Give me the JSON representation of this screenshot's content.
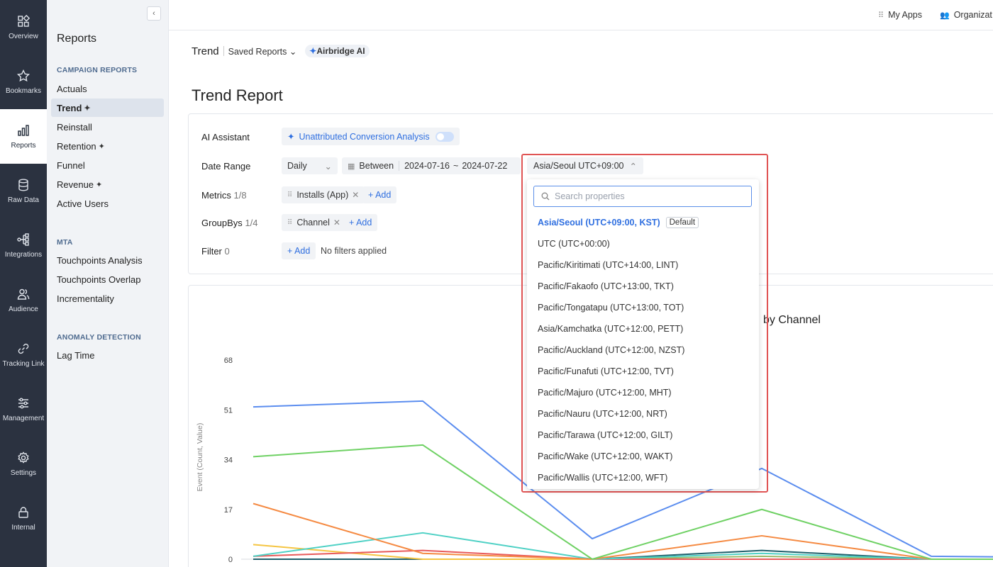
{
  "rail": {
    "items": [
      {
        "label": "Overview",
        "icon": "grid-icon"
      },
      {
        "label": "Bookmarks",
        "icon": "star-icon"
      },
      {
        "label": "Reports",
        "icon": "bar-chart-icon"
      },
      {
        "label": "Raw Data",
        "icon": "database-icon"
      },
      {
        "label": "Integrations",
        "icon": "integrations-icon"
      },
      {
        "label": "Audience",
        "icon": "users-icon"
      },
      {
        "label": "Tracking Link",
        "icon": "link-icon"
      },
      {
        "label": "Management",
        "icon": "sliders-icon"
      },
      {
        "label": "Settings",
        "icon": "gear-icon"
      },
      {
        "label": "Internal",
        "icon": "lock-icon"
      }
    ]
  },
  "sidebar": {
    "title": "Reports",
    "collapse": "‹",
    "sections": [
      {
        "label": "CAMPAIGN REPORTS",
        "items": [
          "Actuals",
          "Trend",
          "Reinstall",
          "Retention",
          "Funnel",
          "Revenue",
          "Active Users"
        ]
      },
      {
        "label": "MTA",
        "items": [
          "Touchpoints Analysis",
          "Touchpoints Overlap",
          "Incrementality"
        ]
      },
      {
        "label": "ANOMALY DETECTION",
        "items": [
          "Lag Time"
        ]
      }
    ]
  },
  "topbar": {
    "my_apps": "My Apps",
    "organization": "Organizat"
  },
  "breadcrumb": {
    "trend": "Trend",
    "saved_reports": "Saved Reports",
    "airbridge_ai": "Airbridge AI"
  },
  "page_title": "Trend Report",
  "settings": {
    "ai_assistant_label": "AI Assistant",
    "ai_assistant_chip": "Unattributed Conversion Analysis",
    "date_range_label": "Date Range",
    "granularity": "Daily",
    "between": "Between",
    "date_start": "2024-07-16",
    "date_sep": "~",
    "date_end": "2024-07-22",
    "metrics_label": "Metrics",
    "metrics_count": "1/8",
    "metric_chip": "Installs (App)",
    "add": "+ Add",
    "groupbys_label": "GroupBys",
    "groupbys_count": "1/4",
    "groupby_chip": "Channel",
    "filter_label": "Filter",
    "filter_count": "0",
    "no_filters": "No filters applied"
  },
  "timezone": {
    "selected": "Asia/Seoul UTC+09:00",
    "search_placeholder": "Search properties",
    "default_tag": "Default",
    "options": [
      "Asia/Seoul (UTC+09:00, KST)",
      "UTC (UTC+00:00)",
      "Pacific/Kiritimati (UTC+14:00, LINT)",
      "Pacific/Fakaofo (UTC+13:00, TKT)",
      "Pacific/Tongatapu (UTC+13:00, TOT)",
      "Asia/Kamchatka (UTC+12:00, PETT)",
      "Pacific/Auckland (UTC+12:00, NZST)",
      "Pacific/Funafuti (UTC+12:00, TVT)",
      "Pacific/Majuro (UTC+12:00, MHT)",
      "Pacific/Nauru (UTC+12:00, NRT)",
      "Pacific/Tarawa (UTC+12:00, GILT)",
      "Pacific/Wake (UTC+12:00, WAKT)",
      "Pacific/Wallis (UTC+12:00, WFT)"
    ]
  },
  "chart_data": {
    "type": "line",
    "title": "by Channel",
    "ylabel": "Event (Count, Value)",
    "ylim": [
      0,
      68
    ],
    "yticks": [
      0,
      17,
      34,
      51,
      68
    ],
    "x": [
      0,
      1,
      2,
      3,
      4,
      5
    ],
    "series": [
      {
        "color": "#5b8def",
        "values": [
          52,
          54,
          7,
          31,
          1,
          0.5
        ]
      },
      {
        "color": "#6fd164",
        "values": [
          35,
          39,
          0,
          17,
          0,
          0
        ]
      },
      {
        "color": "#f58a42",
        "values": [
          19,
          2,
          0,
          8,
          0,
          0
        ]
      },
      {
        "color": "#4fd1c5",
        "values": [
          1,
          9,
          0,
          2,
          0,
          0
        ]
      },
      {
        "color": "#e85a5a",
        "values": [
          1,
          3,
          0,
          0,
          0,
          0
        ]
      },
      {
        "color": "#f5c542",
        "values": [
          5,
          0,
          0,
          0,
          0,
          0
        ]
      },
      {
        "color": "#1f5f6b",
        "values": [
          0,
          0,
          0,
          3,
          0,
          0
        ]
      },
      {
        "color": "#9bb86a",
        "values": [
          0,
          0,
          0,
          1,
          0,
          0
        ]
      }
    ]
  }
}
